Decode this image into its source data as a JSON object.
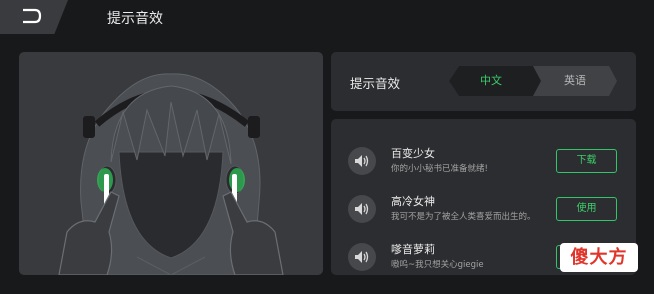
{
  "header": {
    "back_icon": "back-arrow-icon",
    "title": "提示音效"
  },
  "illustration": {
    "description_icon": "girl-with-earbuds-illustration"
  },
  "language": {
    "label": "提示音效",
    "options": [
      {
        "label": "中文",
        "selected": true
      },
      {
        "label": "英语",
        "selected": false
      }
    ]
  },
  "sounds": {
    "items": [
      {
        "name": "百变少女",
        "desc": "你的小小秘书已准备就绪!",
        "action": "下载",
        "icon": "speaker-icon"
      },
      {
        "name": "高冷女神",
        "desc": "我可不是为了被全人类喜爱而出生的。",
        "action": "使用",
        "icon": "speaker-icon"
      },
      {
        "name": "嗲音萝莉",
        "desc": "嗷呜~我只想关心giegie",
        "action": "",
        "icon": "speaker-icon"
      }
    ]
  },
  "watermark": {
    "text": "傻大方"
  },
  "colors": {
    "accent": "#3ccf6a",
    "background": "#18191b",
    "panel": "#2c2d30",
    "watermark_text": "#e0352b"
  }
}
